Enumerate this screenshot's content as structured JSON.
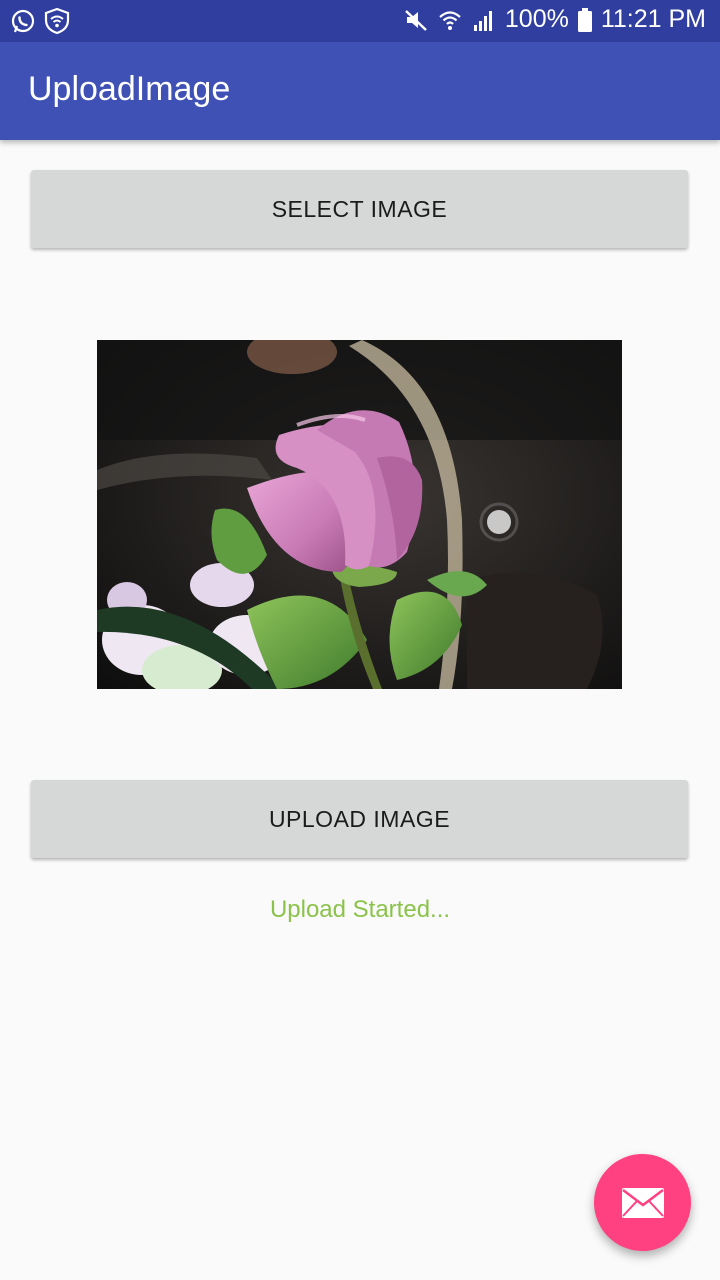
{
  "status_bar": {
    "left_icons": [
      "whatsapp-icon",
      "shield-wifi-icon"
    ],
    "right_icons": [
      "mute-icon",
      "wifi-icon",
      "signal-icon",
      "battery-icon"
    ],
    "battery": "100%",
    "time": "11:21 PM"
  },
  "app_bar": {
    "title": "UploadImage",
    "color": "#3f51b5",
    "status_color": "#303f9f"
  },
  "main": {
    "select_label": "SELECT IMAGE",
    "upload_label": "UPLOAD IMAGE",
    "status_message": "Upload Started...",
    "status_color": "#8bc34a",
    "preview_image": "pink-rose-photo"
  },
  "fab": {
    "icon": "mail-icon",
    "color": "#ff4081"
  }
}
